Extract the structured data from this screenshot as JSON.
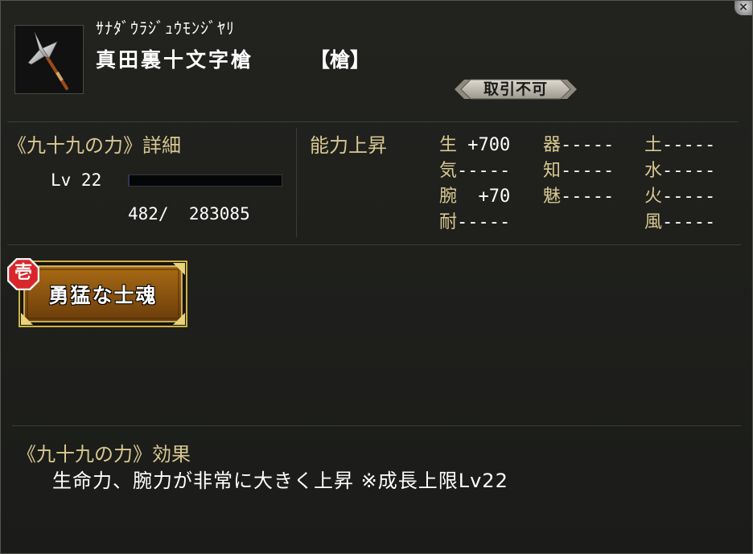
{
  "window": {
    "close_glyph": "×"
  },
  "item": {
    "icon": "spear-icon",
    "kana": "ｻﾅﾀﾞｳﾗｼﾞｭｳﾓﾝｼﾞﾔﾘ",
    "name": "真田裏十文字槍",
    "type": "【槍】",
    "trade_status": "取引不可"
  },
  "detail": {
    "title": "《九十九の力》詳細",
    "level_text": "Lv 22",
    "exp_text": "482/  283085",
    "exp_current": 482,
    "exp_max": 283085
  },
  "stats": {
    "title": "能力上昇",
    "entries": [
      {
        "label": "生",
        "value": " +700"
      },
      {
        "label": "器",
        "value": "-----"
      },
      {
        "label": "土",
        "value": "-----"
      },
      {
        "label": "気",
        "value": "-----"
      },
      {
        "label": "知",
        "value": "-----"
      },
      {
        "label": "水",
        "value": "-----"
      },
      {
        "label": "腕",
        "value": "  +70"
      },
      {
        "label": "魅",
        "value": "-----"
      },
      {
        "label": "火",
        "value": "-----"
      },
      {
        "label": "耐",
        "value": "-----"
      },
      {
        "label": "風",
        "value": "-----"
      }
    ]
  },
  "skill": {
    "rank": "壱",
    "name": "勇猛な士魂"
  },
  "effect": {
    "title": "《九十九の力》効果",
    "text": "生命力、腕力が非常に大きく上昇 ※成長上限Lv22"
  },
  "colors": {
    "background": "#1c1d1a",
    "label_gold": "#d8c891",
    "text_white": "#ffffff",
    "divider": "#3b3c36",
    "exp_fill": "#2c3a70",
    "skill_plate": "#8a5a12",
    "rank_badge": "#d8262b"
  }
}
